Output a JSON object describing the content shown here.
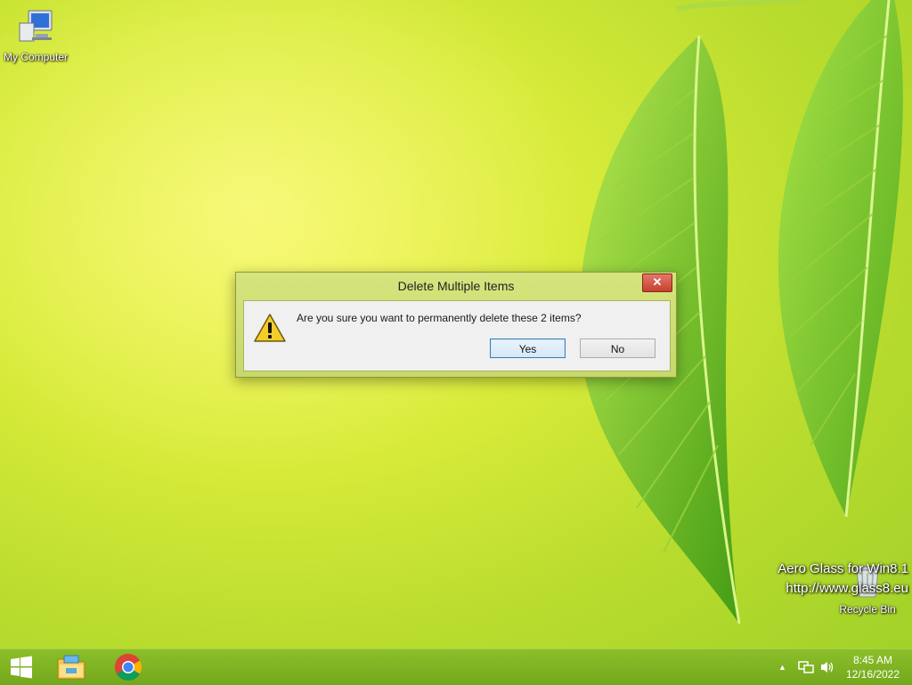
{
  "desktop": {
    "icons": [
      {
        "label": "My Computer"
      },
      {
        "label": "Recycle Bin"
      }
    ],
    "watermark": {
      "line1": "Aero Glass for Win8.1",
      "line2": "http://www.glass8.eu"
    }
  },
  "dialog": {
    "title": "Delete Multiple Items",
    "close_label": "✕",
    "message": "Are you sure you want to permanently delete these 2 items?",
    "yes_label": "Yes",
    "no_label": "No",
    "icon": "warning-icon"
  },
  "taskbar": {
    "items": [
      "start-icon",
      "file-explorer-icon",
      "chrome-icon"
    ],
    "tray": {
      "chevron": "▲",
      "icons": [
        "network-icon",
        "volume-icon"
      ]
    },
    "clock": {
      "time": "8:45 AM",
      "date": "12/16/2022"
    }
  },
  "colors": {
    "taskbar": "#7fb525",
    "dialog_frame": "#cfdf72",
    "close_button": "#d34f3b",
    "default_button_border": "#3c7fb1"
  }
}
